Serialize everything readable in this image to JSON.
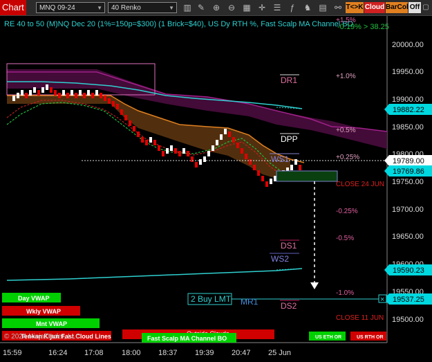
{
  "toolbar": {
    "chart_tab": "Chart",
    "symbol": "MNQ 09-24",
    "bar_type": "40 Renko",
    "btn_tk": "T<>K",
    "btn_cloud": "Cloud",
    "btn_barcol": "BarCol",
    "btn_off": "Off"
  },
  "chart": {
    "header": "RE 40 to 50 (M)NQ Dec 20 (1%=150p=$300) (1 Brick=$40), US Dy RTH %, Fast Scalp MA Channel BO",
    "pnl": "-0.19% > 38.25",
    "pnl_top": "+1.5%",
    "y_ticks": [
      "20000.00",
      "19950.00",
      "19900.00",
      "19850.00",
      "19800.00",
      "19750.00",
      "19700.00",
      "19650.00",
      "19600.00",
      "19550.00",
      "19500.00"
    ],
    "x_ticks": [
      "15:59",
      "16:24",
      "17:08",
      "18:00",
      "18:37",
      "19:39",
      "20:47",
      "25 Jun"
    ],
    "price_tags": {
      "p1": "19882.22",
      "p2": "19789.00",
      "p3": "19769.86",
      "p4": "19590.23",
      "p5": "19537.25"
    },
    "levels": {
      "dr1": "DR1",
      "dpp": "DPP",
      "ws1": "WS1",
      "ds1": "DS1",
      "ws2": "WS2",
      "ds2": "DS2",
      "mr1": "MR1"
    },
    "pct": {
      "p1": "+1.0%",
      "p05": "+0.5%",
      "p025": "+0.25%",
      "m025": "-0.25%",
      "m05": "-0.5%",
      "m1": "-1.0%"
    },
    "close_24": "CLOSE 24 JUN",
    "close_11": "CLOSE 11 JUN",
    "order_label": "2 Buy LMT",
    "order_close": "×",
    "legend": {
      "day_vwap": "Day VWAP",
      "wkly_vwap": "Wkly VWAP",
      "mnt_vwap": "Mnt VWAP",
      "kijun": "Tenkan Kijun Fast Cloud Lines",
      "outside": "Outside Clouds",
      "fast_scalp": "Fast Scalp MA Channel BO",
      "us_eth": "US ETH OR",
      "us_rth": "US RTH OR"
    },
    "copyright": "© 2024 NinjaTrader, LLC",
    "colors": {
      "up_brick": "#ffffff",
      "down_brick": "#e00000",
      "cloud_purple": "#5a0e4a",
      "cloud_orange": "#6b3a10",
      "cyan": "#2fd0d0",
      "tag_cyan": "#00d8e0",
      "green_box": "#0a4010"
    }
  }
}
